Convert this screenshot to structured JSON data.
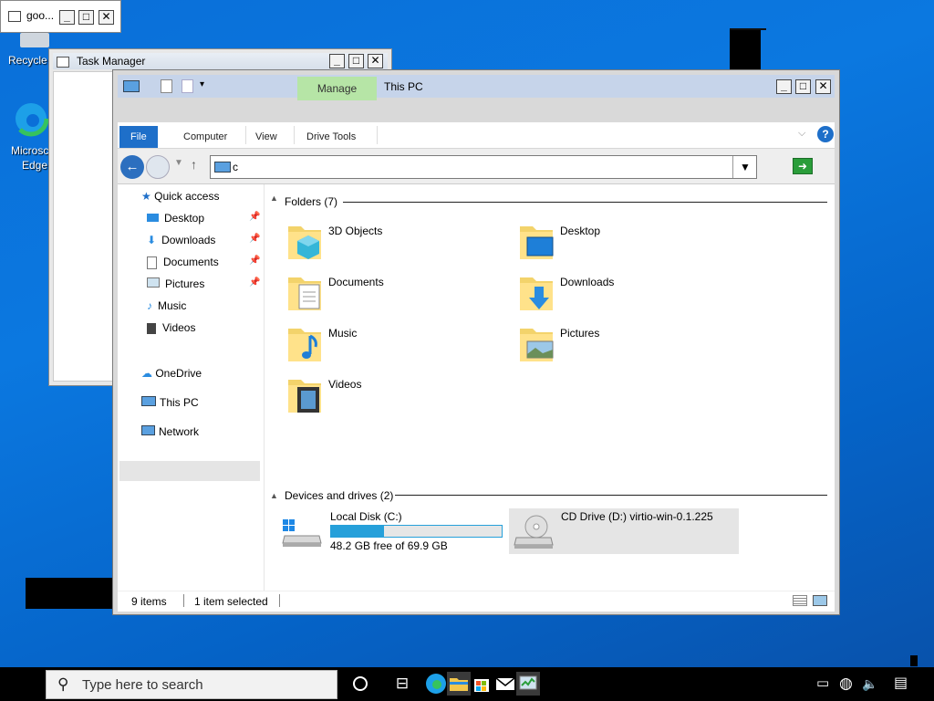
{
  "desktop": {
    "recycle_label": "Recycle",
    "edge_label_1": "Microsc",
    "edge_label_2": "Edge"
  },
  "mini_window": {
    "title": "goo..."
  },
  "task_manager": {
    "title": "Task Manager"
  },
  "explorer": {
    "title": "This PC",
    "manage_tab": "Manage",
    "ribbon": [
      "File",
      "Computer",
      "View",
      "Drive Tools"
    ],
    "address": "c",
    "nav": {
      "quick_access": "Quick access",
      "items": [
        "Desktop",
        "Downloads",
        "Documents",
        "Pictures",
        "Music",
        "Videos"
      ],
      "onedrive": "OneDrive",
      "this_pc": "This PC",
      "network": "Network"
    },
    "folders_header": "Folders (7)",
    "folders": [
      "3D Objects",
      "Desktop",
      "Documents",
      "Downloads",
      "Music",
      "Pictures",
      "Videos"
    ],
    "devices_header": "Devices and drives (2)",
    "drives": {
      "c_name": "Local Disk (C:)",
      "c_free": "48.2 GB free of 69.9 GB",
      "c_used_fraction": 0.31,
      "d_name": "CD Drive (D:) virtio-win-0.1.225"
    },
    "status": {
      "items": "9 items",
      "selected": "1 item selected"
    }
  },
  "taskbar": {
    "search_placeholder": "Type here to search"
  },
  "colors": {
    "accent": "#1e6fc9",
    "manage": "#b6e5a6",
    "drive_bar": "#26a0da"
  }
}
